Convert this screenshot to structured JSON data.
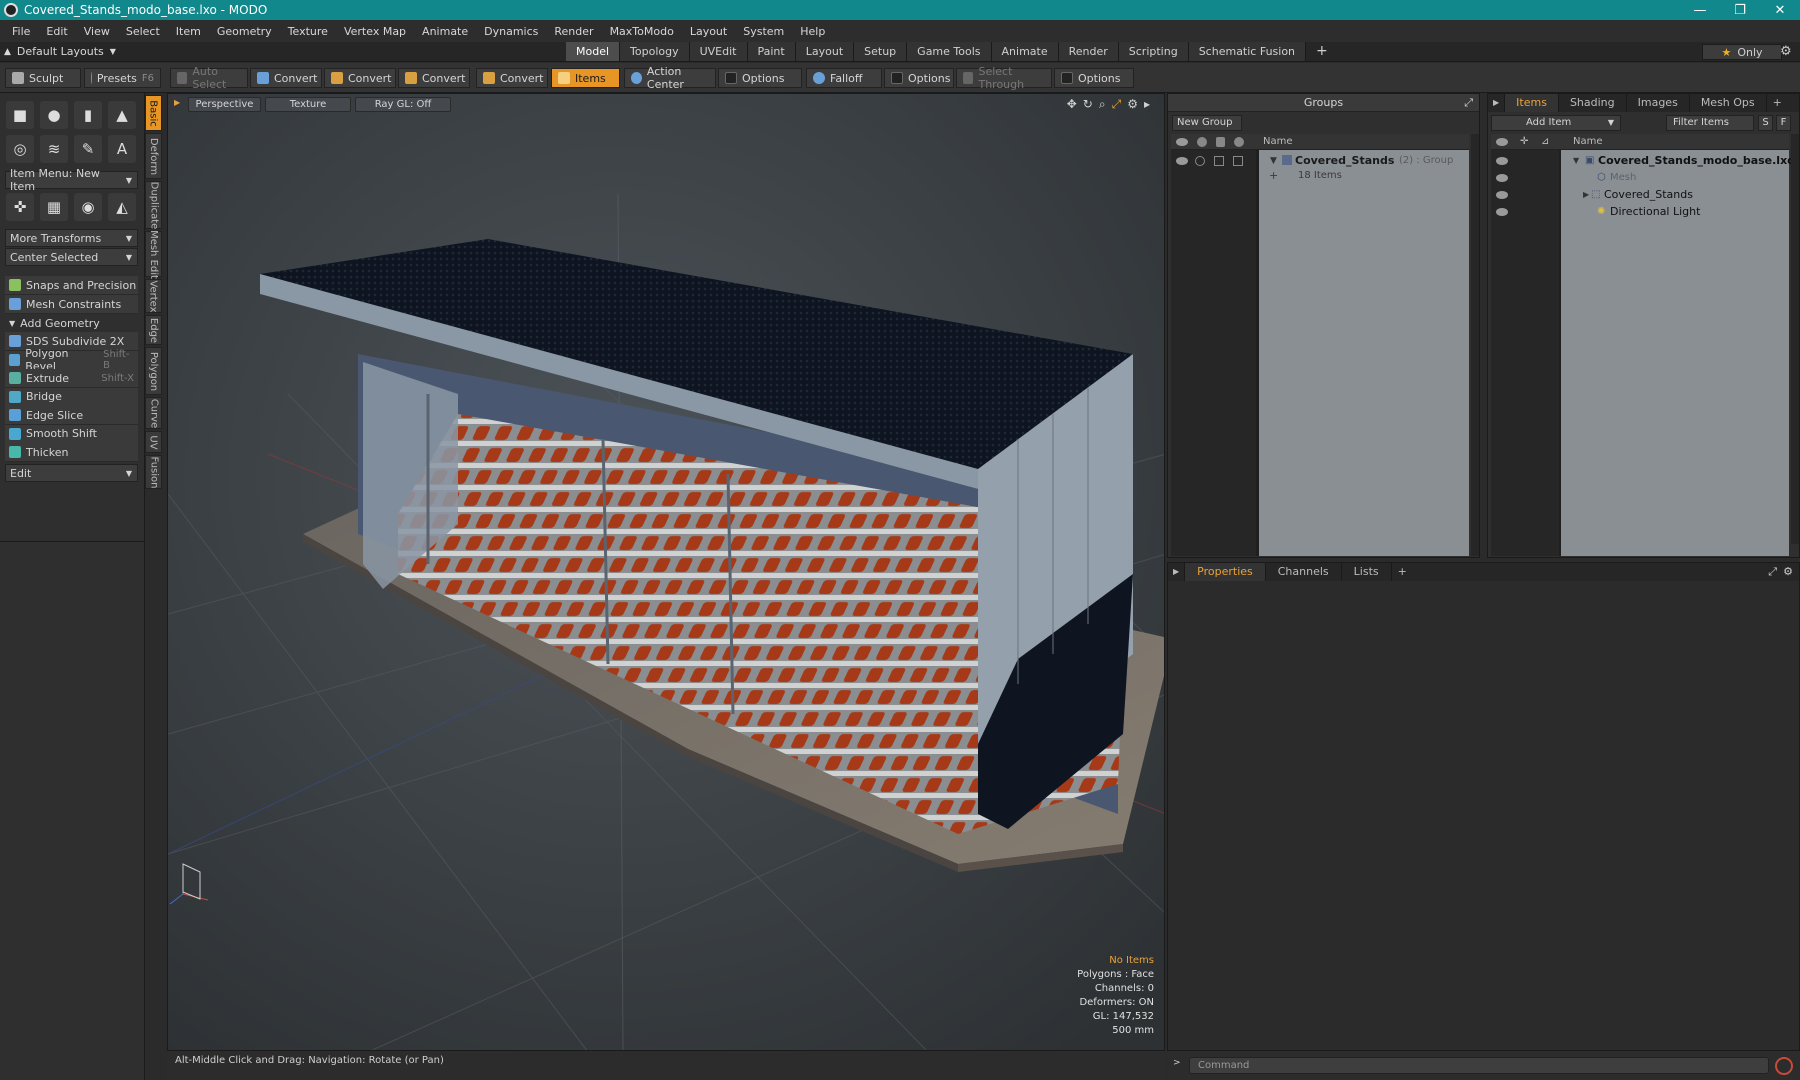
{
  "window": {
    "title": "Covered_Stands_modo_base.lxo - MODO",
    "min": "—",
    "max": "❐",
    "close": "✕"
  },
  "menu": [
    "File",
    "Edit",
    "View",
    "Select",
    "Item",
    "Geometry",
    "Texture",
    "Vertex Map",
    "Animate",
    "Dynamics",
    "Render",
    "MaxToModo",
    "Layout",
    "System",
    "Help"
  ],
  "layout_bar": {
    "default_layouts": "Default Layouts",
    "tabs": [
      "Model",
      "Topology",
      "UVEdit",
      "Paint",
      "Layout",
      "Setup",
      "Game Tools",
      "Animate",
      "Render",
      "Scripting",
      "Schematic Fusion"
    ],
    "active_tab": "Model",
    "plus": "+",
    "only": "Only"
  },
  "toolbar": {
    "sculpt": "Sculpt",
    "presets": "Presets",
    "presets_shortcut": "F6",
    "auto_select": "Auto Select",
    "convert": "Convert",
    "items": "Items",
    "action_center": "Action Center",
    "options": "Options",
    "falloff": "Falloff",
    "select_through": "Select Through"
  },
  "left_panel": {
    "item_menu": "Item Menu: New Item",
    "more_transforms": "More Transforms",
    "center_selected": "Center Selected",
    "snaps": "Snaps and Precision",
    "mesh_constraints": "Mesh Constraints",
    "add_geometry": "Add Geometry",
    "tools": [
      {
        "label": "SDS Subdivide 2X",
        "shortcut": "",
        "color": "#6aa0d8"
      },
      {
        "label": "Polygon Bevel",
        "shortcut": "Shift-B",
        "color": "#5aa0d0"
      },
      {
        "label": "Extrude",
        "shortcut": "Shift-X",
        "color": "#5ab0a0"
      },
      {
        "label": "Bridge",
        "shortcut": "",
        "color": "#50a8c8"
      },
      {
        "label": "Edge Slice",
        "shortcut": "",
        "color": "#5aa0d8"
      },
      {
        "label": "Smooth Shift",
        "shortcut": "",
        "color": "#4aa8d0"
      },
      {
        "label": "Thicken",
        "shortcut": "",
        "color": "#4ab8a8"
      }
    ],
    "edit": "Edit"
  },
  "vertical_tabs": [
    "Basic",
    "Deform",
    "Duplicate",
    "Mesh Edit",
    "Vertex",
    "Edge",
    "Polygon",
    "Curve",
    "UV",
    "Fusion"
  ],
  "viewport": {
    "perspective": "Perspective",
    "texture": "Texture",
    "raygl": "Ray GL: Off",
    "info": {
      "no_items": "No Items",
      "polygons": "Polygons : Face",
      "channels": "Channels: 0",
      "deformers": "Deformers: ON",
      "gl": "GL: 147,532",
      "size": "500 mm"
    }
  },
  "status": {
    "hint": "Alt-Middle Click and Drag:   Navigation: Rotate (or Pan)"
  },
  "groups_panel": {
    "title": "Groups",
    "new_group": "New Group",
    "col_name": "Name",
    "group_name": "Covered_Stands",
    "group_meta": "(2) : Group",
    "group_count": "18 Items"
  },
  "items_panel": {
    "tabs": [
      "Items",
      "Shading",
      "Images",
      "Mesh Ops"
    ],
    "add_item": "Add Item",
    "filter": "Filter Items",
    "s": "S",
    "f": "F",
    "col_name": "Name",
    "tree": [
      {
        "label": "Covered_Stands_modo_base.lxo",
        "indent": 0,
        "bold": true,
        "dim": false
      },
      {
        "label": "Mesh",
        "indent": 2,
        "bold": false,
        "dim": true
      },
      {
        "label": "Covered_Stands",
        "indent": 1,
        "bold": false,
        "dim": false
      },
      {
        "label": "Directional Light",
        "indent": 2,
        "bold": false,
        "dim": false
      }
    ]
  },
  "properties_panel": {
    "tabs": [
      "Properties",
      "Channels",
      "Lists"
    ]
  },
  "command": {
    "placeholder": "Command"
  }
}
